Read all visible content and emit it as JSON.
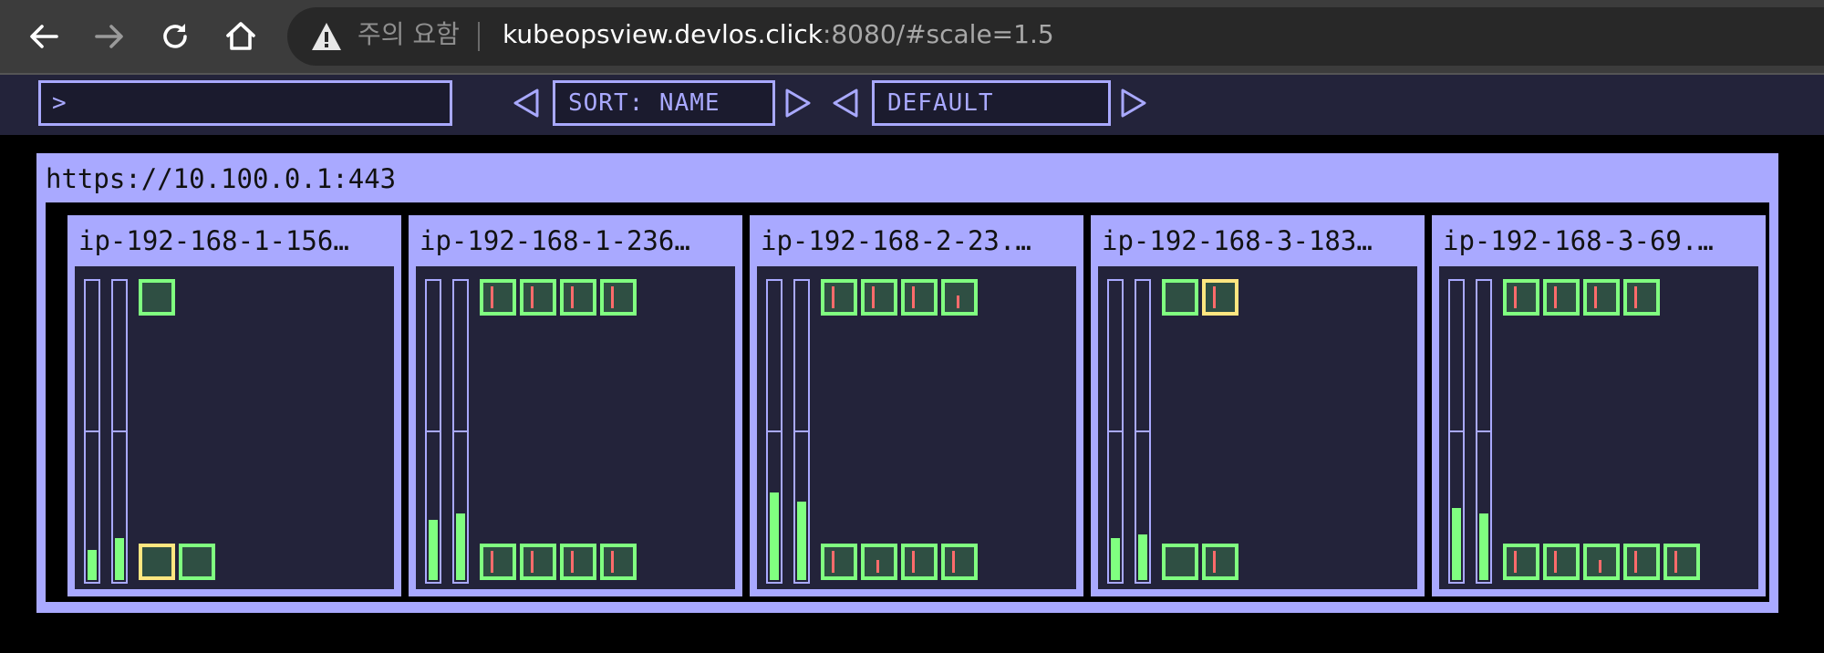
{
  "browser": {
    "security_warning": "주의 요함",
    "url_host": "kubeopsview.devlos.click",
    "url_rest": ":8080/#scale=1.5",
    "icons": [
      "back-arrow-icon",
      "forward-arrow-icon",
      "reload-icon",
      "home-icon",
      "warning-triangle-icon"
    ]
  },
  "toolbar": {
    "filter_placeholder": ">",
    "sort_label": "SORT: NAME",
    "theme_label": "DEFAULT"
  },
  "colors": {
    "accent": "#a9a9ff",
    "panel": "#23233a",
    "pod_ok": "#80ff80",
    "pod_warn": "#ffe680",
    "pod_usage": "#ff6b6b"
  },
  "cluster": {
    "api_server": "https://10.100.0.1:443",
    "nodes": [
      {
        "name": "ip-192-168-1-156…",
        "cpu_usage": 0.1,
        "memory_usage": 0.14,
        "system_pods": [
          {
            "status": "ok",
            "usage": []
          }
        ],
        "app_pods": [
          {
            "status": "warn",
            "usage": []
          },
          {
            "status": "ok",
            "usage": []
          }
        ]
      },
      {
        "name": "ip-192-168-1-236…",
        "cpu_usage": 0.2,
        "memory_usage": 0.22,
        "system_pods": [
          {
            "status": "ok",
            "usage": [
              "cpu"
            ]
          },
          {
            "status": "ok",
            "usage": [
              "cpu"
            ]
          },
          {
            "status": "ok",
            "usage": [
              "cpu"
            ]
          },
          {
            "status": "ok",
            "usage": [
              "cpu"
            ]
          }
        ],
        "app_pods": [
          {
            "status": "ok",
            "usage": [
              "cpu"
            ]
          },
          {
            "status": "ok",
            "usage": [
              "cpu"
            ]
          },
          {
            "status": "ok",
            "usage": [
              "cpu"
            ]
          },
          {
            "status": "ok",
            "usage": [
              "cpu"
            ]
          }
        ]
      },
      {
        "name": "ip-192-168-2-23.…",
        "cpu_usage": 0.29,
        "memory_usage": 0.26,
        "system_pods": [
          {
            "status": "ok",
            "usage": [
              "cpu"
            ]
          },
          {
            "status": "ok",
            "usage": [
              "cpu"
            ]
          },
          {
            "status": "ok",
            "usage": [
              "cpu"
            ]
          },
          {
            "status": "ok",
            "usage": [
              "mem"
            ]
          }
        ],
        "app_pods": [
          {
            "status": "ok",
            "usage": [
              "cpu"
            ]
          },
          {
            "status": "ok",
            "usage": [
              "mem"
            ]
          },
          {
            "status": "ok",
            "usage": [
              "cpu"
            ]
          },
          {
            "status": "ok",
            "usage": [
              "cpu"
            ]
          }
        ]
      },
      {
        "name": "ip-192-168-3-183…",
        "cpu_usage": 0.14,
        "memory_usage": 0.15,
        "system_pods": [
          {
            "status": "ok",
            "usage": []
          },
          {
            "status": "warn",
            "usage": [
              "cpu"
            ]
          }
        ],
        "app_pods": [
          {
            "status": "ok",
            "usage": []
          },
          {
            "status": "ok",
            "usage": [
              "cpu"
            ]
          }
        ]
      },
      {
        "name": "ip-192-168-3-69.…",
        "cpu_usage": 0.24,
        "memory_usage": 0.22,
        "system_pods": [
          {
            "status": "ok",
            "usage": [
              "cpu"
            ]
          },
          {
            "status": "ok",
            "usage": [
              "cpu"
            ]
          },
          {
            "status": "ok",
            "usage": [
              "cpu"
            ]
          },
          {
            "status": "ok",
            "usage": [
              "cpu"
            ]
          }
        ],
        "app_pods": [
          {
            "status": "ok",
            "usage": [
              "cpu"
            ]
          },
          {
            "status": "ok",
            "usage": [
              "cpu"
            ]
          },
          {
            "status": "ok",
            "usage": [
              "mem"
            ]
          },
          {
            "status": "ok",
            "usage": [
              "cpu"
            ]
          },
          {
            "status": "ok",
            "usage": [
              "cpu"
            ]
          }
        ]
      }
    ]
  }
}
